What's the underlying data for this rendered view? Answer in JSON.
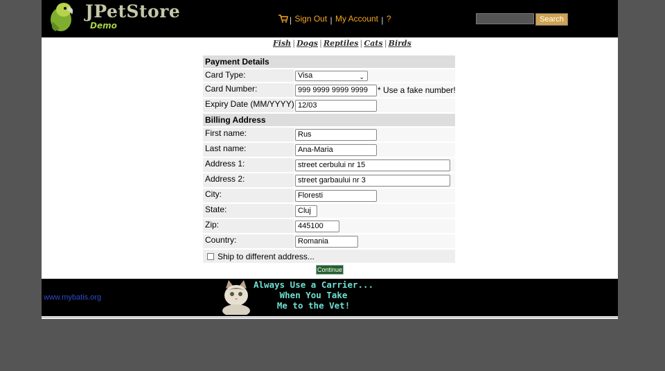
{
  "header": {
    "logo_title": "JPetStore",
    "logo_subtitle": "Demo",
    "menu": {
      "sign_out": "Sign Out",
      "my_account": "My Account",
      "help": "?",
      "separator": "|"
    },
    "search": {
      "value": "",
      "button_label": "Search"
    }
  },
  "categories": [
    "Fish",
    "Dogs",
    "Reptiles",
    "Cats",
    "Birds"
  ],
  "payment": {
    "section_title": "Payment Details",
    "card_type_label": "Card Type:",
    "card_type_value": "Visa",
    "card_number_label": "Card Number:",
    "card_number_value": "999 9999 9999 9999",
    "card_number_note": "* Use a fake number!",
    "expiry_label": "Expiry Date (MM/YYYY):",
    "expiry_value": "12/03"
  },
  "billing": {
    "section_title": "Billing Address",
    "first_name_label": "First name:",
    "first_name": "Rus",
    "last_name_label": "Last name:",
    "last_name": "Ana-Maria",
    "address1_label": "Address 1:",
    "address1": "street cerbului nr 15",
    "address2_label": "Address 2:",
    "address2": "street garbaului nr 3",
    "city_label": "City:",
    "city": "Floresti",
    "state_label": "State:",
    "state": "Cluj",
    "zip_label": "Zip:",
    "zip": "445100",
    "country_label": "Country:",
    "country": "Romania"
  },
  "ship_different_label": "Ship to different address...",
  "continue_label": "Continue",
  "footer": {
    "link": "www.mybatis.org",
    "banner_text": "Always Use a Carrier...\nWhen You Take\nMe to the Vet!"
  },
  "colors": {
    "header_bg": "#000000",
    "link_orange": "#f5a623",
    "continue_green": "#26612b",
    "outer_bg": "#555555"
  }
}
